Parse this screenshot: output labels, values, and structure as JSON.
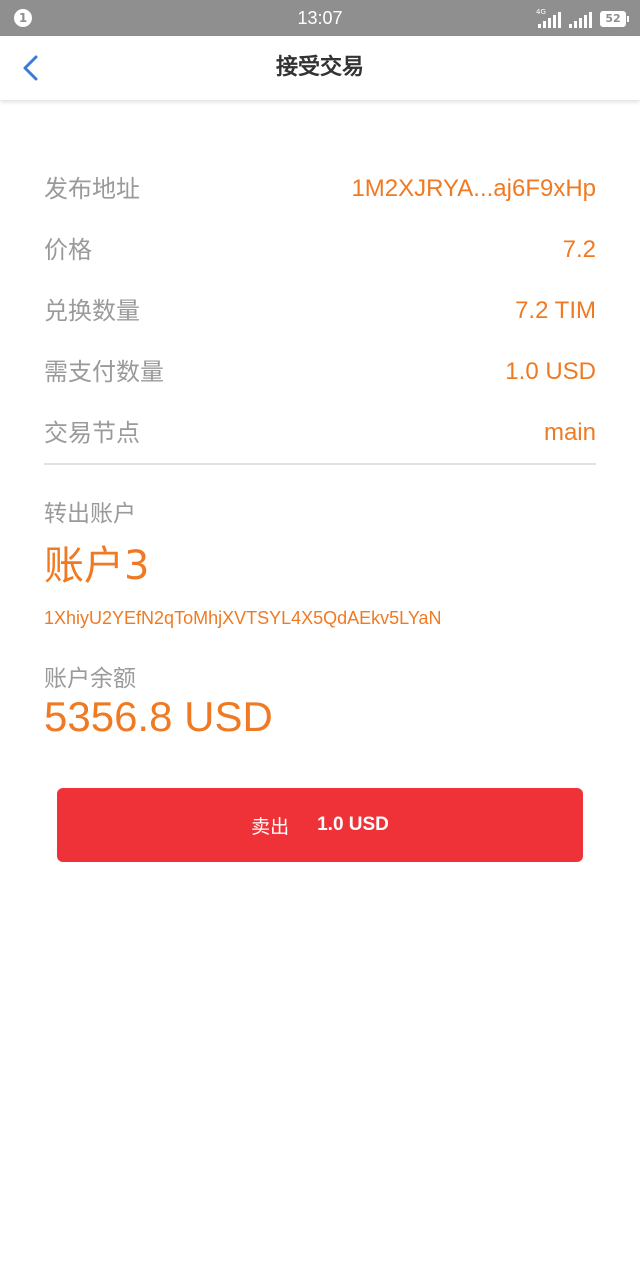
{
  "status_bar": {
    "notification_count": "1",
    "time": "13:07",
    "network_tag": "4G",
    "battery": "52"
  },
  "header": {
    "title": "接受交易",
    "back_icon": "chevron-left-icon"
  },
  "details": [
    {
      "label": "发布地址",
      "value": "1M2XJRYA...aj6F9xHp"
    },
    {
      "label": "价格",
      "value": "7.2"
    },
    {
      "label": "兑换数量",
      "value": "7.2 TIM"
    },
    {
      "label": "需支付数量",
      "value": "1.0 USD"
    },
    {
      "label": "交易节点",
      "value": "main"
    }
  ],
  "account": {
    "section_label": "转出账户",
    "name": "账户3",
    "address": "1XhiyU2YEfN2qToMhjXVTSYL4X5QdAEkv5LYaN",
    "balance_label": "账户余额",
    "balance": "5356.8 USD"
  },
  "action": {
    "label": "卖出",
    "amount": "1.0 USD"
  },
  "colors": {
    "accent": "#f07a23",
    "button": "#ee3237",
    "label": "#9a9a9a",
    "status_bar": "#8f8f8f"
  }
}
